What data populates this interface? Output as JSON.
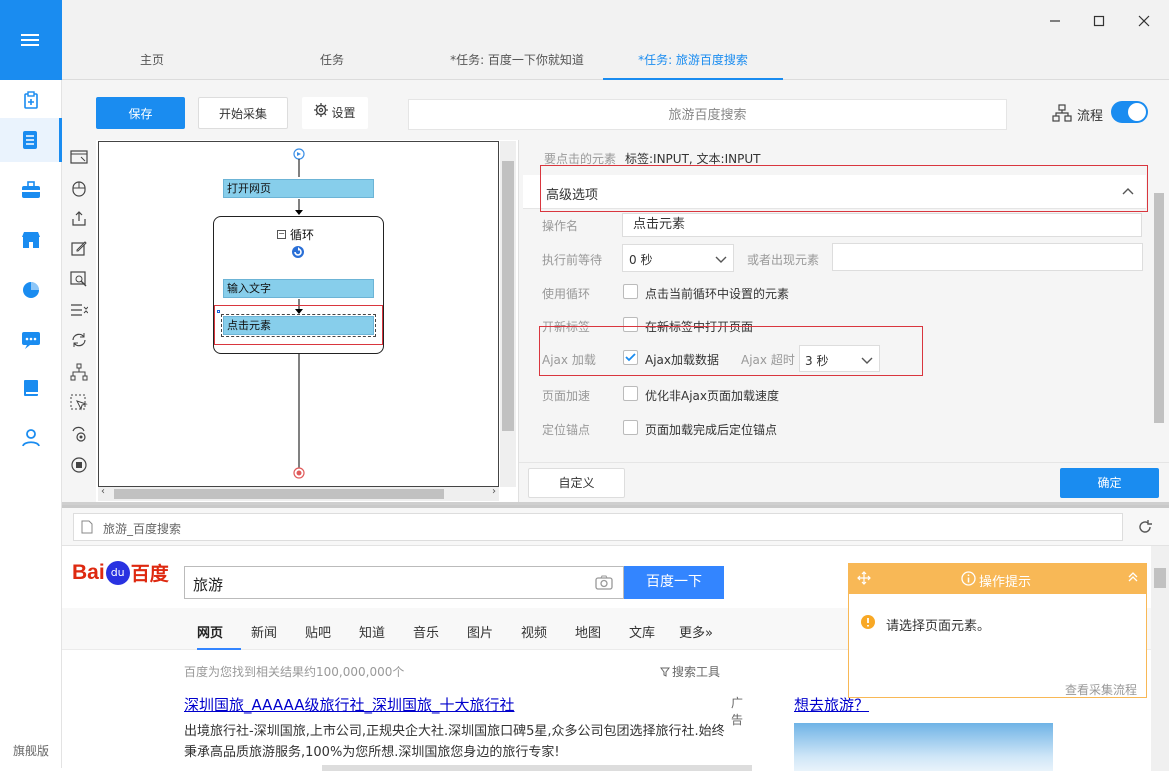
{
  "left_nav": {
    "edition": "旗舰版"
  },
  "tabs": [
    {
      "label": "主页"
    },
    {
      "label": "任务"
    },
    {
      "label": "*任务: 百度一下你就知道"
    },
    {
      "label": "*任务: 旅游百度搜索"
    }
  ],
  "toolbar": {
    "save": "保存",
    "start": "开始采集",
    "settings": "设置",
    "task_name": "旅游百度搜索",
    "flow_label": "流程"
  },
  "flow": {
    "open_page": "打开网页",
    "loop": "循环",
    "input_text": "输入文字",
    "click_element": "点击元素"
  },
  "panel": {
    "target_label": "要点击的元素",
    "target_value": "标签:INPUT, 文本:INPUT",
    "advanced": "高级选项",
    "op_name_label": "操作名",
    "op_name_value": "点击元素",
    "wait_label": "执行前等待",
    "wait_value": "0 秒",
    "or_appear_label": "或者出现元素",
    "loop_label": "使用循环",
    "loop_text": "点击当前循环中设置的元素",
    "newtab_label": "开新标签",
    "newtab_text": "在新标签中打开页面",
    "ajax_label": "Ajax 加载",
    "ajax_text": "Ajax加载数据",
    "ajax_timeout_label": "Ajax 超时",
    "ajax_timeout_value": "3 秒",
    "speed_label": "页面加速",
    "speed_text": "优化非Ajax页面加载速度",
    "anchor_label": "定位锚点",
    "anchor_text": "页面加载完成后定位锚点",
    "custom": "自定义",
    "ok": "确定"
  },
  "browser": {
    "address": "旅游_百度搜索",
    "logo": "Bai du 百度",
    "query": "旅游",
    "search_btn": "百度一下",
    "nav": [
      "网页",
      "新闻",
      "贴吧",
      "知道",
      "音乐",
      "图片",
      "视频",
      "地图",
      "文库",
      "更多»"
    ],
    "result_count": "百度为您找到相关结果约100,000,000个",
    "search_tools": "搜索工具",
    "ad": "广告",
    "result_title": "深圳国旅_AAAAA级旅行社_深圳国旅_十大旅行社",
    "result_line1": "出境旅行社-深圳国旅,上市公司,正规央企大社.深圳国旅口碑5星,众多公司包团选择旅行社.始终",
    "result_line2": "秉承高品质旅游服务,100%为您所想.深圳国旅您身边的旅行专家!",
    "right_title": "想去旅游？"
  },
  "tip": {
    "title": "操作提示",
    "message": "请选择页面元素。",
    "link": "查看采集流程"
  },
  "colors": {
    "accent": "#1a8cf0",
    "red_box": "#d9363e",
    "tip_orange": "#f8b856"
  }
}
